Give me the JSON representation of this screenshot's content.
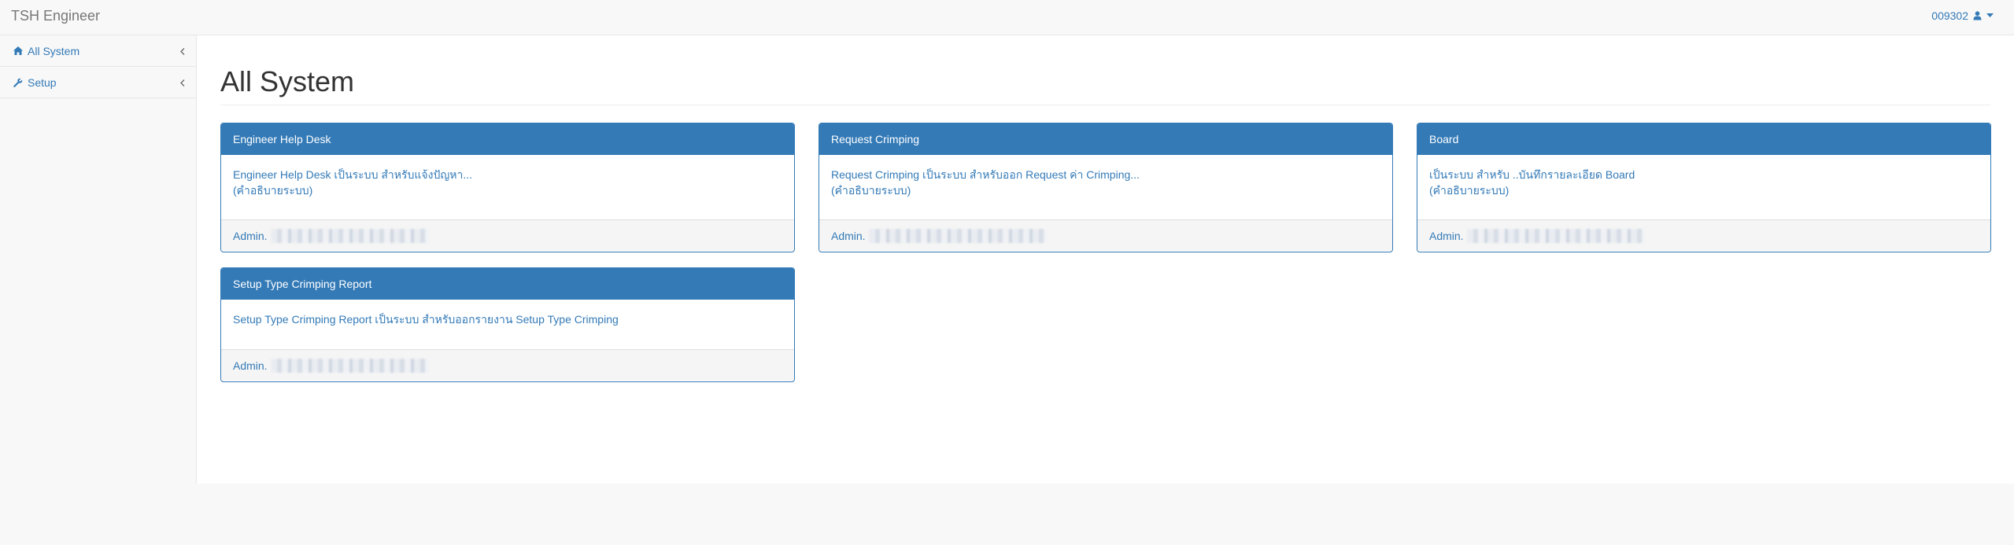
{
  "navbar": {
    "brand": "TSH Engineer",
    "user": "009302"
  },
  "sidebar": {
    "items": [
      {
        "label": "All System",
        "icon": "home-icon"
      },
      {
        "label": "Setup",
        "icon": "wrench-icon"
      }
    ]
  },
  "main": {
    "title": "All System",
    "panels": [
      {
        "heading": "Engineer Help Desk",
        "line1": "Engineer Help Desk เป็นระบบ สำหรับแจ้งปัญหา...",
        "line2": "(คำอธิบายระบบ)",
        "footer": "Admin."
      },
      {
        "heading": "Request Crimping",
        "line1": "Request Crimping เป็นระบบ สำหรับออก Request ค่า Crimping...",
        "line2": "(คำอธิบายระบบ)",
        "footer": "Admin."
      },
      {
        "heading": "Board",
        "line1": "เป็นระบบ สำหรับ ..บันทึกรายละเอียด Board",
        "line2": "(คำอธิบายระบบ)",
        "footer": "Admin."
      },
      {
        "heading": "Setup Type Crimping Report",
        "line1": "Setup Type Crimping Report เป็นระบบ สำหรับออกรายงาน Setup Type Crimping",
        "line2": "",
        "footer": "Admin."
      }
    ]
  },
  "colors": {
    "primary": "#337ab7",
    "navbar_bg": "#f8f8f8",
    "panel_footer_bg": "#f5f5f5"
  }
}
